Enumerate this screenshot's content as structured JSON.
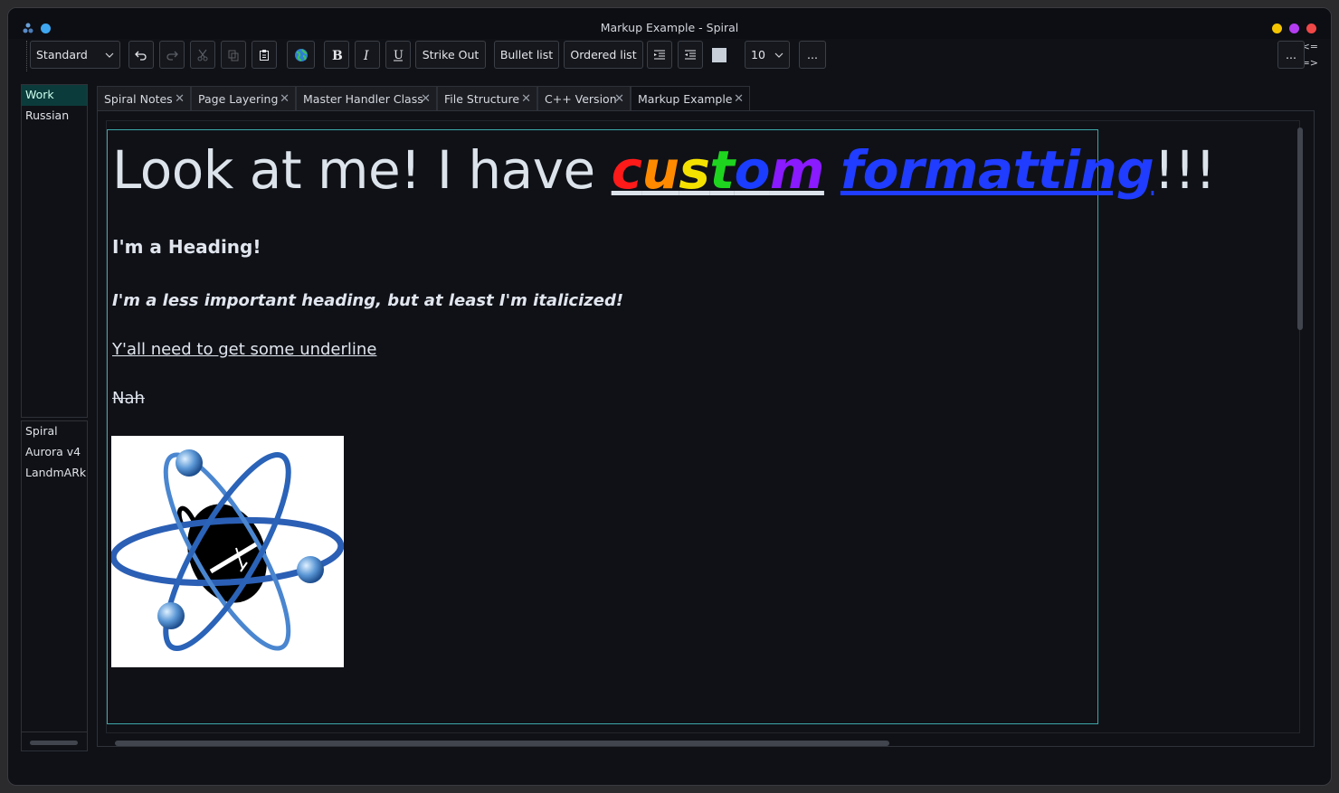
{
  "window": {
    "title": "Markup Example - Spiral",
    "controls": {
      "minimize_color": "#f5c400",
      "maximize_color": "#b43cf0",
      "close_color": "#f04747"
    }
  },
  "toolbar": {
    "style_select": "Standard",
    "strike_label": "Strike Out",
    "bullet_label": "Bullet list",
    "ordered_label": "Ordered list",
    "font_size": "10",
    "more_label": "...",
    "right_more_label": "...",
    "icons": [
      "undo-icon",
      "redo-icon",
      "cut-icon",
      "copy-icon",
      "paste-icon",
      "globe-icon",
      "bold-icon",
      "italic-icon",
      "underline-icon",
      "indent-icon",
      "outdent-icon"
    ]
  },
  "nav": {
    "back": "<=",
    "forward": "=>"
  },
  "sidebar": {
    "groups": [
      {
        "label": "Work",
        "active": true
      },
      {
        "label": "Russian",
        "active": false
      }
    ],
    "projects": [
      "Spiral",
      "Aurora v4",
      "LandmARk"
    ]
  },
  "tabs": [
    {
      "label": "Spiral Notes",
      "active": false
    },
    {
      "label": "Page Layering",
      "active": false
    },
    {
      "label": "Master Handler Class",
      "active": false
    },
    {
      "label": "File Structure",
      "active": false
    },
    {
      "label": "C++ Version",
      "active": false
    },
    {
      "label": "Markup Example",
      "active": true
    }
  ],
  "document": {
    "big_prefix": "Look at me! I have ",
    "rainbow_letters": [
      {
        "ch": "c",
        "color": "#ff1a1a"
      },
      {
        "ch": "u",
        "color": "#ff8a00"
      },
      {
        "ch": "s",
        "color": "#f5e100"
      },
      {
        "ch": "t",
        "color": "#1fd41f"
      },
      {
        "ch": "o",
        "color": "#1a3dff"
      },
      {
        "ch": "m",
        "color": "#8a1aff"
      }
    ],
    "space": " ",
    "blue_word": "formatting",
    "blue_color": "#1f3cff",
    "big_suffix": "!!!",
    "heading": "I'm a Heading!",
    "subheading": "I'm a less important heading, but at least I'm italicized!",
    "underlined": "Y'all need to get some underline",
    "struck": "Nah"
  },
  "colors": {
    "accent": "#3ca7a8",
    "background": "#0f1117"
  }
}
